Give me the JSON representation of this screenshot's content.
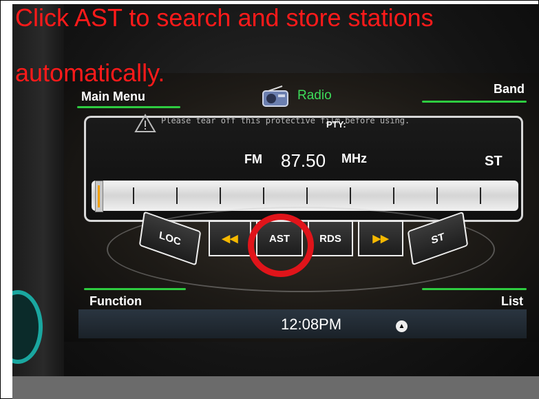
{
  "caption": {
    "line1": "Click AST to search and store stations",
    "line2": "automatically."
  },
  "head_unit": {
    "main_menu": "Main Menu",
    "title": "Radio",
    "band": "Band",
    "protective_note": "Please tear off this protective film before using.",
    "pty_label": "PTY:",
    "band_name": "FM",
    "frequency": "87.50",
    "unit": "MHz",
    "stereo": "ST",
    "buttons": {
      "loc": "LOC",
      "prev": "◀◀",
      "ast": "AST",
      "rds": "RDS",
      "next": "▶▶",
      "st": "ST"
    },
    "function": "Function",
    "list": "List",
    "clock": "12:08PM",
    "eject": "▲"
  },
  "colors": {
    "caption": "#ff1a1a",
    "accent_green": "#2ecc40",
    "highlight_circle": "#e0141a",
    "seek_yellow": "#f5b800"
  },
  "icons": [
    "radio-icon",
    "warning-icon",
    "seek-back-icon",
    "seek-forward-icon",
    "eject-icon"
  ]
}
